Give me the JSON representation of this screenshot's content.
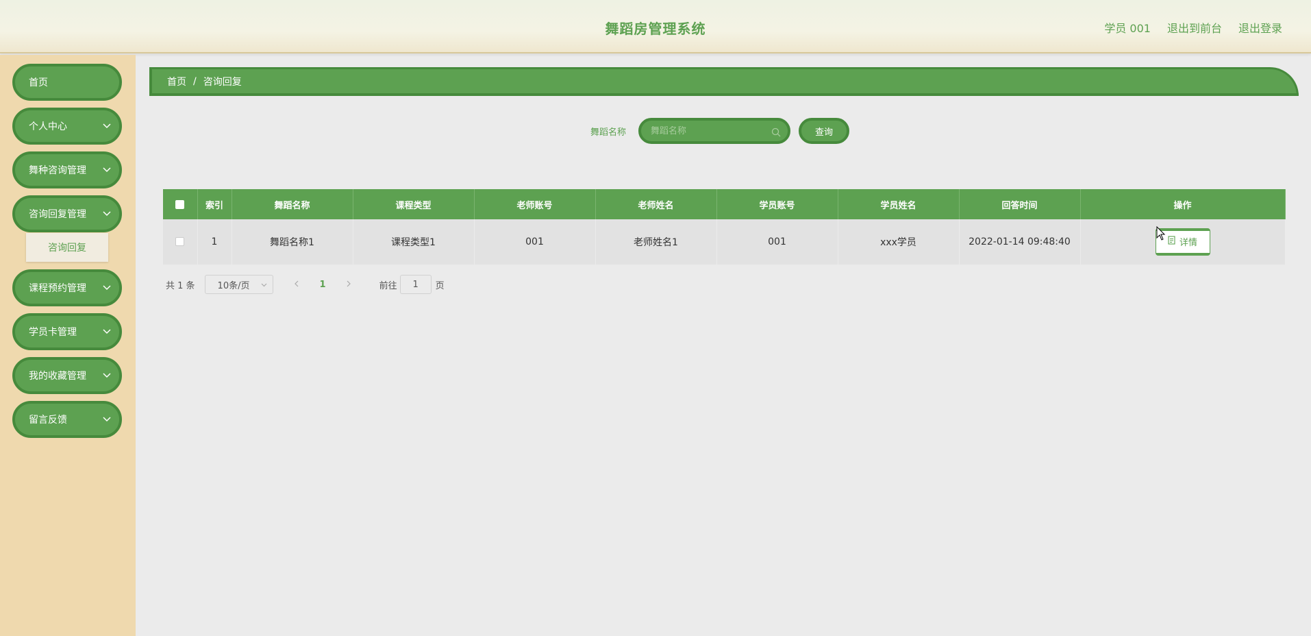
{
  "header": {
    "title": "舞蹈房管理系统",
    "user": "学员 001",
    "to_front": "退出到前台",
    "logout": "退出登录"
  },
  "sidebar": {
    "items": [
      {
        "label": "首页",
        "has_arrow": false
      },
      {
        "label": "个人中心",
        "has_arrow": true
      },
      {
        "label": "舞种咨询管理",
        "has_arrow": true
      },
      {
        "label": "咨询回复管理",
        "has_arrow": true
      },
      {
        "label": "课程预约管理",
        "has_arrow": true
      },
      {
        "label": "学员卡管理",
        "has_arrow": true
      },
      {
        "label": "我的收藏管理",
        "has_arrow": true
      },
      {
        "label": "留言反馈",
        "has_arrow": true
      }
    ],
    "sub_item": "咨询回复"
  },
  "breadcrumb": {
    "home": "首页",
    "sep": "/",
    "current": "咨询回复"
  },
  "search": {
    "label": "舞蹈名称",
    "placeholder": "舞蹈名称",
    "button": "查询"
  },
  "table": {
    "headers": [
      "索引",
      "舞蹈名称",
      "课程类型",
      "老师账号",
      "老师姓名",
      "学员账号",
      "学员姓名",
      "回答时间",
      "操作"
    ],
    "rows": [
      {
        "index": "1",
        "dance_name": "舞蹈名称1",
        "course_type": "课程类型1",
        "teacher_account": "001",
        "teacher_name": "老师姓名1",
        "student_account": "001",
        "student_name": "xxx学员",
        "reply_time": "2022-01-14 09:48:40",
        "action": "详情"
      }
    ]
  },
  "pagination": {
    "total": "共 1 条",
    "page_size": "10条/页",
    "current_page": "1",
    "goto_label": "前往",
    "goto_value": "1",
    "goto_unit": "页"
  },
  "colors": {
    "accent": "#5da151",
    "accent_dark": "#468a3c",
    "sidebar_bg": "#efd9ae",
    "content_bg": "#ebebeb"
  }
}
